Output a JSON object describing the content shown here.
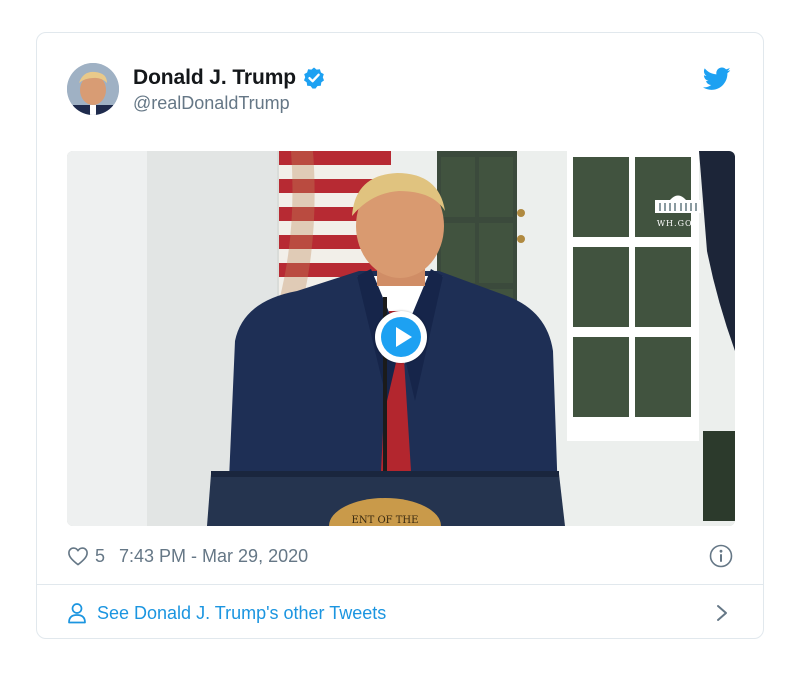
{
  "tweet": {
    "display_name": "Donald J. Trump",
    "handle": "@realDonaldTrump",
    "verified": true,
    "like_count": "5",
    "timestamp": "7:43 PM - Mar 29, 2020"
  },
  "video": {
    "watermark_text": "WH.GOV",
    "seal_text": "ENT OF THE"
  },
  "footer": {
    "label": "See Donald J. Trump's other Tweets"
  },
  "icons": {
    "verified": "verified-badge-icon",
    "twitter": "twitter-bird-icon",
    "play": "play-icon",
    "heart": "heart-icon",
    "info": "info-icon",
    "person": "person-icon",
    "chevron": "chevron-right-icon"
  },
  "colors": {
    "twitter_blue": "#1da1f2",
    "link_blue": "#1b95e0",
    "text_dark": "#14171a",
    "text_gray": "#657786",
    "border": "#e1e8ed"
  }
}
